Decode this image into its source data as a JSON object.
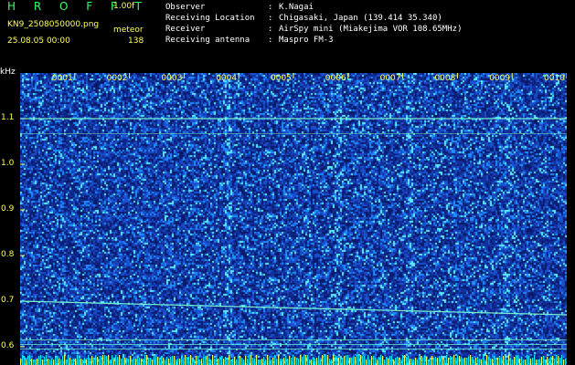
{
  "header": {
    "app_title": "H R O F F T",
    "gain": "1.00f",
    "file_name": "KN9_2508050000.png",
    "meteor_label": "meteor",
    "date_time": "25.08.05 00:00",
    "meteor_count": "138"
  },
  "info": [
    {
      "key": "Observer",
      "sep": ":",
      "value": "K.Nagai"
    },
    {
      "key": "Receiving Location",
      "sep": ":",
      "value": "Chigasaki, Japan (139.414 35.340)"
    },
    {
      "key": "Receiver",
      "sep": ":",
      "value": "AirSpy mini (Miakejima VOR 108.65MHz)"
    },
    {
      "key": "Receiving antenna",
      "sep": ":",
      "value": "Maspro FM-3"
    }
  ],
  "axes": {
    "y_unit": "kHz",
    "y_ticks": [
      "1.1",
      "1.0",
      "0.9",
      "0.8",
      "0.7",
      "0.6"
    ],
    "x_ticks": [
      "0001",
      "0002",
      "0003",
      "0004",
      "0005",
      "0006",
      "0007",
      "0008",
      "0009",
      "0010"
    ]
  },
  "colors": {
    "background": "#0a1a6a",
    "noise_bright": "#2ec8ff",
    "trace": "#7fffd4",
    "label": "#ffff55"
  }
}
